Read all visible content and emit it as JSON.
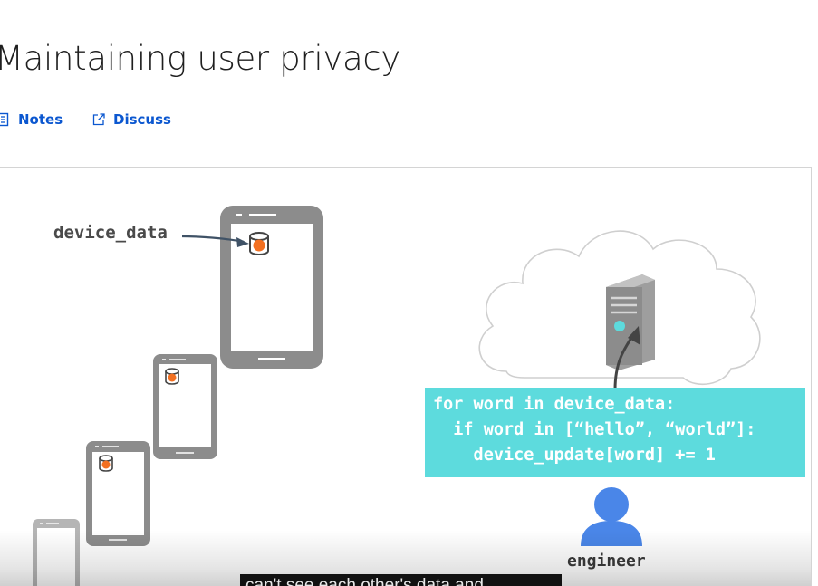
{
  "page": {
    "title": "Maintaining user privacy"
  },
  "tabs": [
    {
      "label": "Notes",
      "icon": "notes-icon"
    },
    {
      "label": "Discuss",
      "icon": "external-link-icon"
    }
  ],
  "video": {
    "device_label": "device_data",
    "code_lines": [
      "for word in device_data:",
      "  if word in [“hello”, “world”]:",
      "    device_update[word] += 1"
    ],
    "engineer_label": "engineer",
    "caption": "can't see each other's data and"
  },
  "colors": {
    "accent_link": "#0b57d0",
    "code_bg": "#5ddbdd",
    "phone_gray": "#8c8c8c",
    "data_orange": "#f37021",
    "engineer_blue": "#4a86e8",
    "cloud_outline": "#cfcfcf"
  }
}
